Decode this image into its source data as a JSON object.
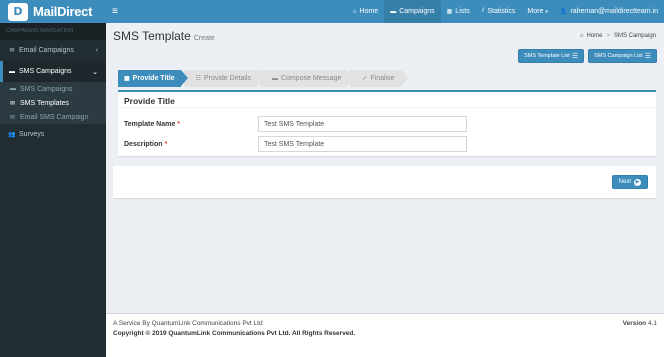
{
  "brand": {
    "logo_glyph": "D",
    "name": "MailDirect",
    "color": "#3c8dbc"
  },
  "sidebar": {
    "header": "CAMPAIGNS NAVIGATION",
    "email_campaigns": "Email Campaigns",
    "sms_campaigns": "SMS Campaigns",
    "sub": [
      "SMS Campaigns",
      "SMS Templates",
      "Email SMS Campaign"
    ],
    "surveys": "Surveys"
  },
  "topbar": {
    "home": "Home",
    "campaigns": "Campaigns",
    "lists": "Lists",
    "statistics": "Statistics",
    "more": "More",
    "user": "raheman@maildirectteam.in"
  },
  "page": {
    "title": "SMS Template",
    "subtitle": "Create",
    "breadcrumb_home": "Home",
    "breadcrumb_current": "SMS Campaign",
    "btn_template_list": "SMS Template List",
    "btn_campaign_list": "SMS Campaign List"
  },
  "steps": [
    "Provide Title",
    "Provide Details",
    "Compose Message",
    "Finalise"
  ],
  "form": {
    "box_title": "Provide Title",
    "name_label": "Template Name",
    "name_value": "Test SMS Template",
    "desc_label": "Description",
    "desc_value": "Test SMS Template",
    "required_mark": "*"
  },
  "next_label": "Next",
  "footer": {
    "service": "A Service By QuantumLink Communications Pvt Ltd",
    "copyright": "Copyright © 2019 QuantumLink Communications Pvt Ltd. All Rights Reserved.",
    "version_label": "Version",
    "version_value": "4.1"
  }
}
